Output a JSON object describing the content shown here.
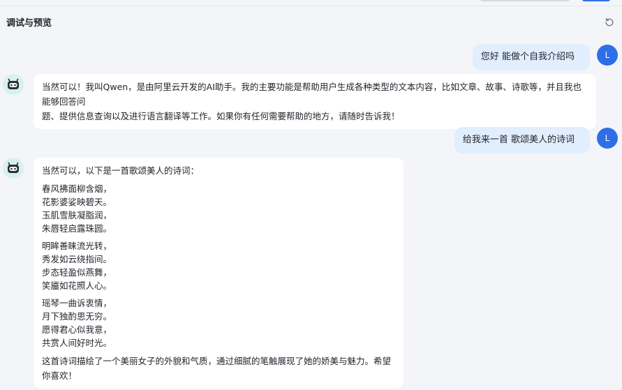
{
  "header": {
    "title": "调试与预览"
  },
  "icons": {
    "refresh": "refresh-icon",
    "bot": "robot-face-icon"
  },
  "colors": {
    "accent": "#2f6fe6",
    "user_bubble": "#e1eefe",
    "bot_avatar_bg": "#d8f1ef"
  },
  "user": {
    "avatar_letter": "L"
  },
  "messages": [
    {
      "role": "user",
      "text": "您好 能做个自我介绍吗"
    },
    {
      "role": "assistant",
      "lines": [
        "当然可以！我叫Qwen，是由阿里云开发的AI助手。我的主要功能是帮助用户生成各种类型的文本内容，比如文章、故事、诗歌等，并且我也能够回答问",
        "题、提供信息查询以及进行语言翻译等工作。如果你有任何需要帮助的地方，请随时告诉我！"
      ]
    },
    {
      "role": "user",
      "text": "给我来一首 歌颂美人的诗词"
    },
    {
      "role": "assistant",
      "intro": "当然可以，以下是一首歌颂美人的诗词：",
      "stanzas": [
        [
          "春风拂面柳含烟，",
          "花影婆娑映碧天。",
          "玉肌雪肤凝脂润，",
          "朱唇轻启露珠圆。"
        ],
        [
          "明眸善睐流光转，",
          "秀发如云绕指间。",
          "步态轻盈似燕舞，",
          "笑靥如花照人心。"
        ],
        [
          "瑶琴一曲诉衷情，",
          "月下独酌思无穷。",
          "愿得君心似我意，",
          "共赏人间好时光。"
        ]
      ],
      "outro": "这首诗词描绘了一个美丽女子的外貌和气质，通过细腻的笔触展现了她的娇美与魅力。希望你喜欢！"
    }
  ]
}
